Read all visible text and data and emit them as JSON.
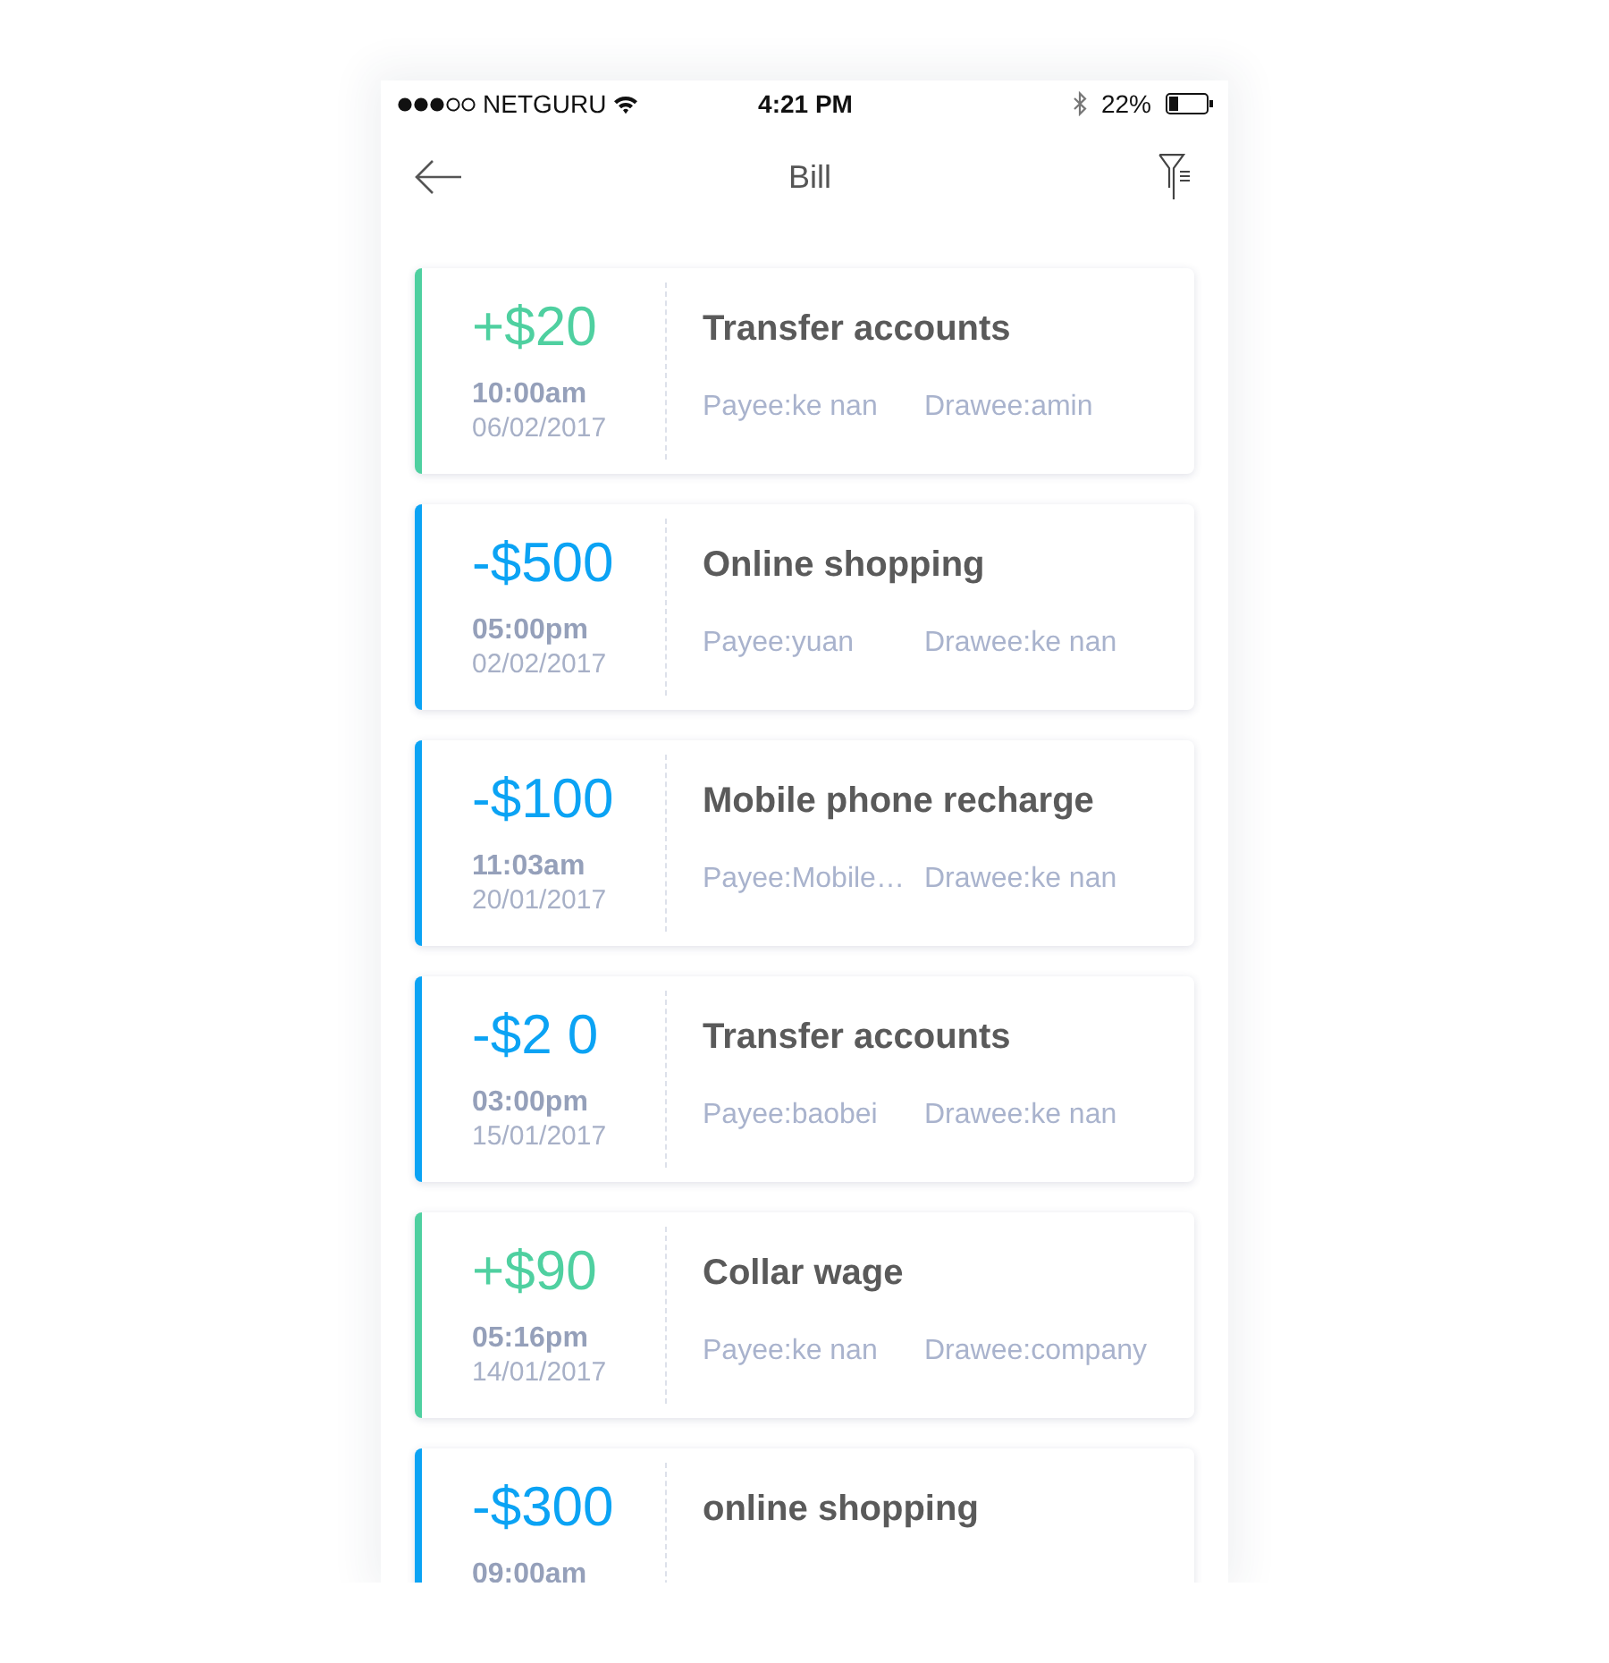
{
  "status_bar": {
    "carrier": "NETGURU",
    "time": "4:21 PM",
    "battery": "22%"
  },
  "header": {
    "title": "Bill"
  },
  "bills": [
    {
      "kind": "income",
      "amount": "+$20",
      "time": "10:00am",
      "date": "06/02/2017",
      "title": "Transfer accounts",
      "payee": "Payee:ke nan",
      "drawee": "Drawee:amin"
    },
    {
      "kind": "expense",
      "amount": "-$500",
      "time": "05:00pm",
      "date": "02/02/2017",
      "title": "Online shopping",
      "payee": "Payee:yuan",
      "drawee": "Drawee:ke nan"
    },
    {
      "kind": "expense",
      "amount": "-$100",
      "time": "11:03am",
      "date": "20/01/2017",
      "title": "Mobile phone recharge",
      "payee": "Payee:Mobile…",
      "drawee": "Drawee:ke nan"
    },
    {
      "kind": "expense",
      "amount": "-$2 0",
      "time": "03:00pm",
      "date": "15/01/2017",
      "title": "Transfer accounts",
      "payee": "Payee:baobei",
      "drawee": "Drawee:ke nan"
    },
    {
      "kind": "income",
      "amount": "+$90",
      "time": "05:16pm",
      "date": "14/01/2017",
      "title": "Collar wage",
      "payee": "Payee:ke nan",
      "drawee": "Drawee:company"
    },
    {
      "kind": "expense",
      "amount": "-$300",
      "time": "09:00am",
      "title": "online shopping"
    }
  ]
}
